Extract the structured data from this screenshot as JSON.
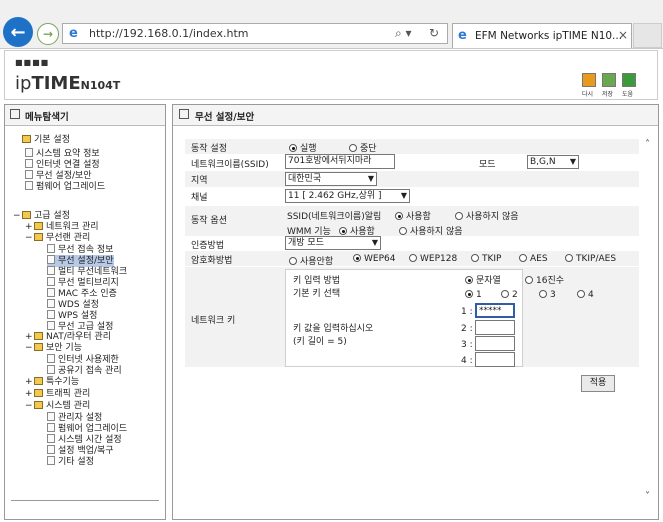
{
  "browser": {
    "url": "http://192.168.0.1/index.htm",
    "tab_title": "EFM Networks ipTIME N10...",
    "tab_close": "×",
    "search_glyph": "⌕ ▾",
    "refresh_glyph": "↻"
  },
  "header": {
    "logo_dots": "■■■■",
    "logo_ip": "ip",
    "logo_time": "TIME",
    "logo_model": "N104T",
    "icons": [
      {
        "name": "home-icon",
        "label": "다시",
        "color": "#e89a1f"
      },
      {
        "name": "save-icon",
        "label": "저장",
        "color": "#6aa84f"
      },
      {
        "name": "help-icon",
        "label": "도움",
        "color": "#3c9a3c"
      }
    ]
  },
  "left": {
    "title": "메뉴탐색기",
    "tree": [
      {
        "text": "기본 설정",
        "level": 0,
        "type": "folder",
        "expander": ""
      },
      {
        "text": "시스템 요약 정보",
        "level": 1,
        "type": "leaf-icon"
      },
      {
        "text": "인터넷 연결 설정",
        "level": 1,
        "type": "leaf-icon"
      },
      {
        "text": "무선 설정/보안",
        "level": 1,
        "type": "leaf-icon"
      },
      {
        "text": "펌웨어 업그레이드",
        "level": 1,
        "type": "leaf-icon"
      },
      {
        "text": "고급 설정",
        "level": 0,
        "type": "folder",
        "expander": "−"
      },
      {
        "text": "네트워크 관리",
        "level": 1,
        "type": "folder",
        "expander": "+"
      },
      {
        "text": "무선랜 관리",
        "level": 1,
        "type": "folder",
        "expander": "−"
      },
      {
        "text": "무선 접속 정보",
        "level": 2,
        "type": "page"
      },
      {
        "text": "무선 설정/보안",
        "level": 2,
        "type": "page",
        "selected": true
      },
      {
        "text": "멀티 무선네트워크",
        "level": 2,
        "type": "page"
      },
      {
        "text": "무선 멀티브리지",
        "level": 2,
        "type": "page"
      },
      {
        "text": "MAC 주소 인증",
        "level": 2,
        "type": "page"
      },
      {
        "text": "WDS 설정",
        "level": 2,
        "type": "page"
      },
      {
        "text": "WPS 설정",
        "level": 2,
        "type": "page"
      },
      {
        "text": "무선 고급 설정",
        "level": 2,
        "type": "page"
      },
      {
        "text": "NAT/라우터 관리",
        "level": 1,
        "type": "folder",
        "expander": "+"
      },
      {
        "text": "보안 기능",
        "level": 1,
        "type": "folder",
        "expander": "−"
      },
      {
        "text": "인터넷 사용제한",
        "level": 2,
        "type": "page"
      },
      {
        "text": "공유기 접속 관리",
        "level": 2,
        "type": "page"
      },
      {
        "text": "특수기능",
        "level": 1,
        "type": "folder",
        "expander": "+"
      },
      {
        "text": "트래픽 관리",
        "level": 1,
        "type": "folder",
        "expander": "+"
      },
      {
        "text": "시스템 관리",
        "level": 1,
        "type": "folder",
        "expander": "−"
      },
      {
        "text": "관리자 설정",
        "level": 2,
        "type": "page"
      },
      {
        "text": "펌웨어 업그레이드",
        "level": 2,
        "type": "page"
      },
      {
        "text": "시스템 시간 설정",
        "level": 2,
        "type": "page"
      },
      {
        "text": "설정 백업/복구",
        "level": 2,
        "type": "page"
      },
      {
        "text": "기타 설정",
        "level": 2,
        "type": "page"
      }
    ]
  },
  "right": {
    "title": "무선 설정/보안",
    "operation": {
      "label": "동작 설정",
      "on": "실행",
      "off": "중단",
      "selected": "on"
    },
    "ssid": {
      "label": "네트워크이름(SSID)",
      "value": "701호방에서뒤지마라"
    },
    "mode": {
      "label": "모드",
      "value": "B,G,N"
    },
    "region": {
      "label": "지역",
      "value": "대한민국"
    },
    "channel": {
      "label": "채널",
      "value": "11 [ 2.462 GHz,상위 ]"
    },
    "options": {
      "label": "동작 옵션",
      "ssid_broadcast": "SSID(네트워크이름)알림",
      "wmm": "WMM 기능",
      "use": "사용함",
      "notuse": "사용하지 않음"
    },
    "auth": {
      "label": "인증방법",
      "value": "개방 모드"
    },
    "encryption": {
      "label": "암호화방법",
      "options": [
        "사용안함",
        "WEP64",
        "WEP128",
        "TKIP",
        "AES",
        "TKIP/AES"
      ],
      "selected": "WEP64"
    },
    "network_key": {
      "label": "네트워크 키",
      "input_method_label": "키 입력 방법",
      "input_text": "문자열",
      "input_hex": "16진수",
      "default_key_label": "기본 키 선택",
      "default_key_options": [
        "1",
        "2",
        "3",
        "4"
      ],
      "enter_key_label": "키 값을 입력하십시오",
      "key_length": "(키 길이 = 5)",
      "keys": [
        {
          "idx": "1 :",
          "value": "*****"
        },
        {
          "idx": "2 :",
          "value": ""
        },
        {
          "idx": "3 :",
          "value": ""
        },
        {
          "idx": "4 :",
          "value": ""
        }
      ]
    },
    "apply_label": "적용",
    "scroll_up": "˄",
    "scroll_down": "˅"
  }
}
